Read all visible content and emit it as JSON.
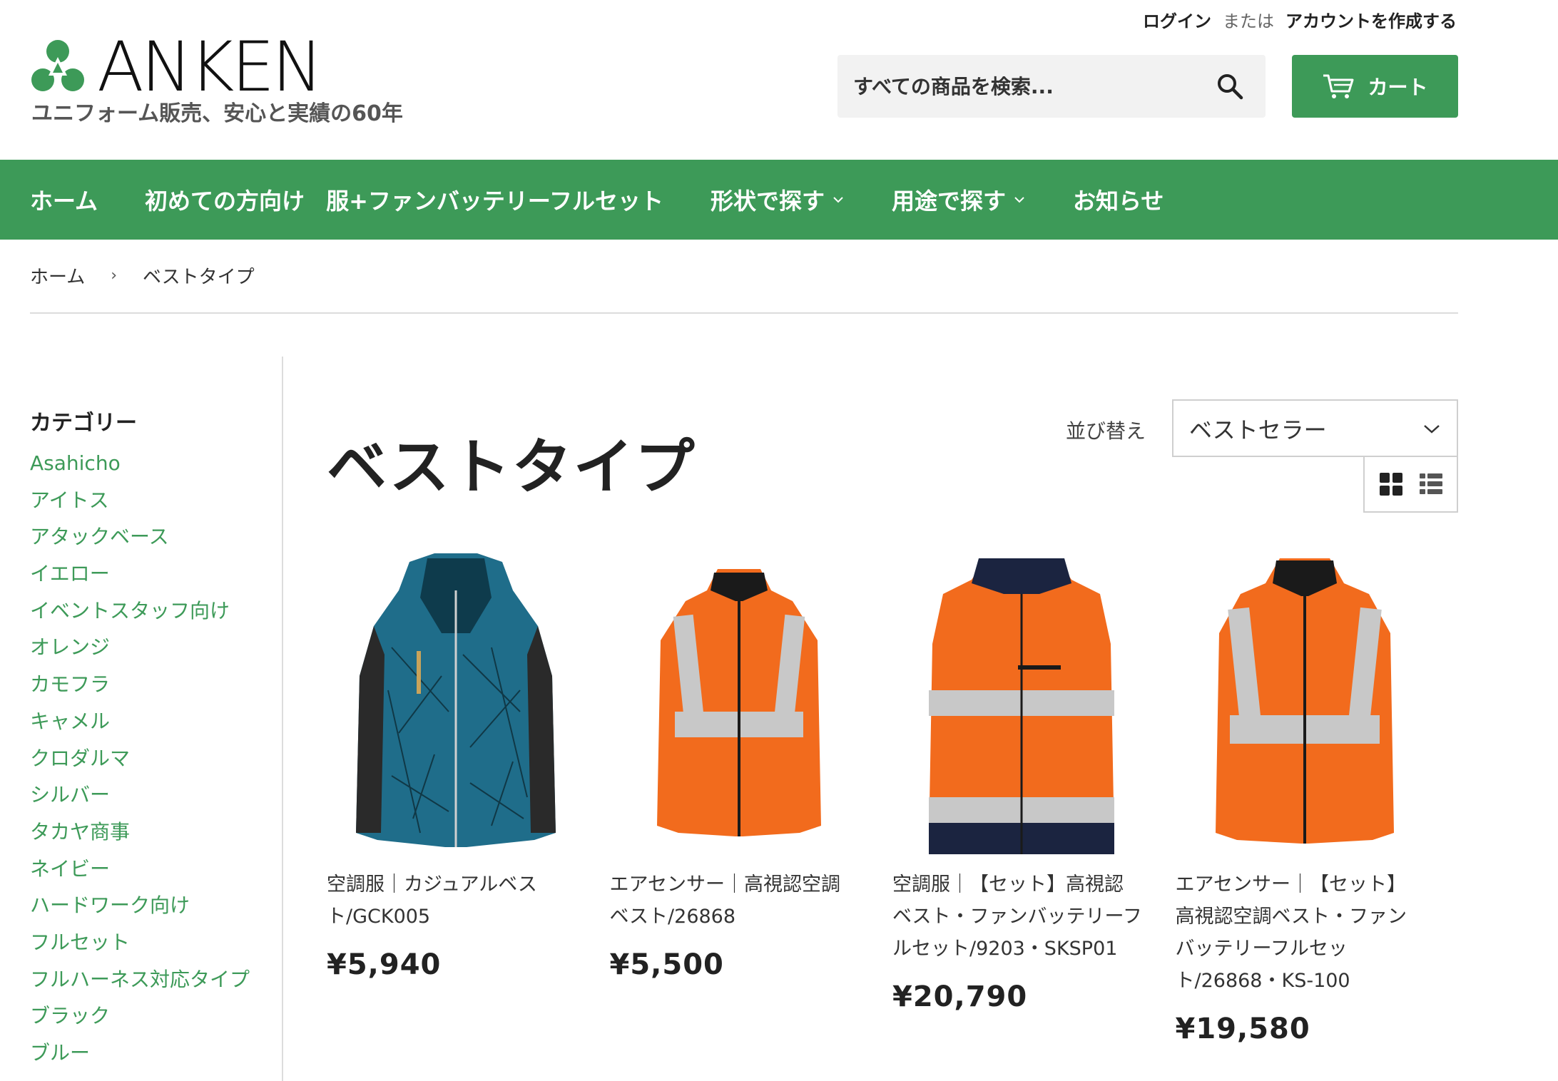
{
  "header": {
    "login_label": "ログイン",
    "or_label": "または",
    "create_account_label": "アカウントを作成する",
    "logo_text": "ANKEN",
    "tagline": "ユニフォーム販売、安心と実績の60年",
    "search_placeholder": "すべての商品を検索...",
    "cart_label": "カート",
    "brand_color": "#3d9a58"
  },
  "nav": {
    "items": [
      {
        "label": "ホーム"
      },
      {
        "label": "初めての方向け"
      },
      {
        "label": "服+ファンバッテリーフルセット"
      },
      {
        "label": "形状で探す",
        "dropdown": true
      },
      {
        "label": "用途で探す",
        "dropdown": true
      },
      {
        "label": "お知らせ"
      }
    ]
  },
  "breadcrumb": {
    "home": "ホーム",
    "separator": "›",
    "current": "ベストタイプ"
  },
  "sidebar": {
    "heading": "カテゴリー",
    "categories": [
      "Asahicho",
      "アイトス",
      "アタックベース",
      "イエロー",
      "イベントスタッフ向け",
      "オレンジ",
      "カモフラ",
      "キャメル",
      "クロダルマ",
      "シルバー",
      "タカヤ商事",
      "ネイビー",
      "ハードワーク向け",
      "フルセット",
      "フルハーネス対応タイプ",
      "ブラック",
      "ブルー"
    ]
  },
  "main": {
    "title": "ベストタイプ",
    "sort_label": "並び替え",
    "sort_selected": "ベストセラー",
    "view_modes": [
      "grid-icon",
      "list-icon"
    ],
    "products": [
      {
        "title": "空調服｜カジュアルベスト/GCK005",
        "price": "¥5,940",
        "image": "blue-patterned-vest"
      },
      {
        "title": "エアセンサー｜高視認空調ベスト/26868",
        "price": "¥5,500",
        "image": "orange-reflective-vest"
      },
      {
        "title": "空調服｜【セット】高視認ベスト・ファンバッテリーフルセット/9203・SKSP01",
        "price": "¥20,790",
        "image": "orange-navy-collar-vest"
      },
      {
        "title": "エアセンサー｜【セット】高視認空調ベスト・ファンバッテリーフルセット/26868・KS-100",
        "price": "¥19,580",
        "image": "orange-reflective-vest-set"
      }
    ]
  }
}
